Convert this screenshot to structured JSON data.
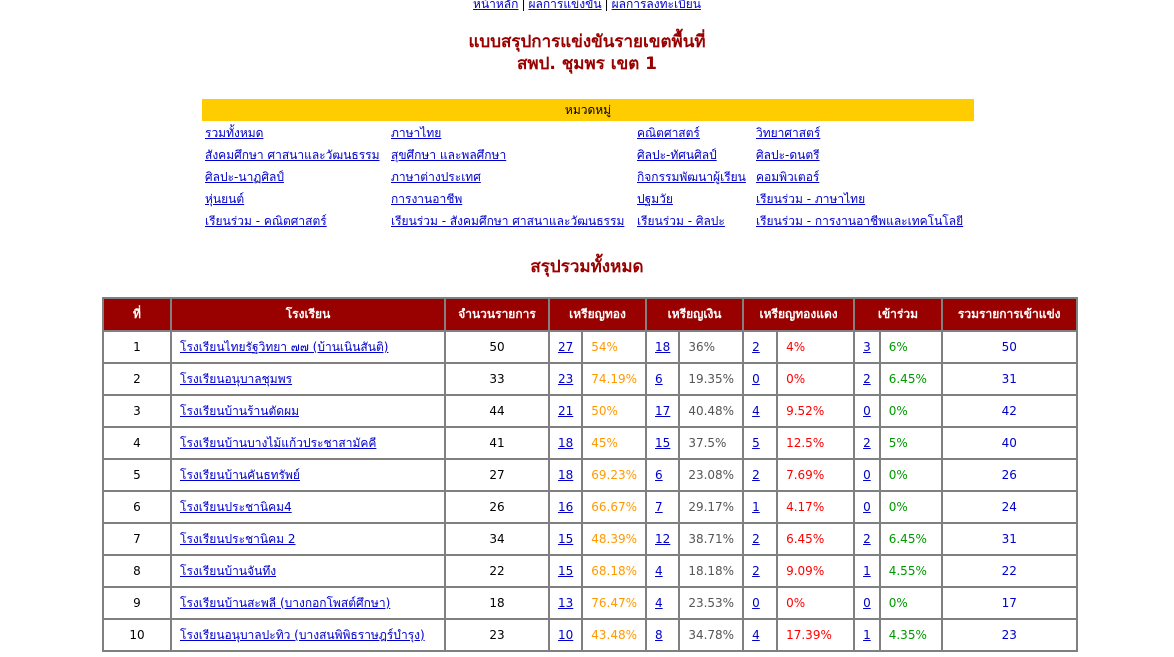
{
  "nav": [
    {
      "label": "หน้าหลัก"
    },
    {
      "label": "ผลการแข่งขัน"
    },
    {
      "label": "ผลการลงทะเบียน"
    }
  ],
  "nav_separator": "|",
  "title": {
    "line1": "แบบสรุปการแข่งขันรายเขตพื้นที่",
    "line2": "สพป. ชุมพร เขต 1"
  },
  "categories_header": "หมวดหมู่",
  "categories": [
    [
      "รวมทั้งหมด",
      "ภาษาไทย",
      "คณิตศาสตร์",
      "วิทยาศาสตร์"
    ],
    [
      "สังคมศึกษา ศาสนาและวัฒนธรรม",
      "สุขศึกษา และพลศึกษา",
      "ศิลปะ-ทัศนศิลป์",
      "ศิลปะ-ดนตรี"
    ],
    [
      "ศิลปะ-นาฏศิลป์",
      "ภาษาต่างประเทศ",
      "กิจกรรมพัฒนาผู้เรียน",
      "คอมพิวเตอร์"
    ],
    [
      "หุ่นยนต์",
      "การงานอาชีพ",
      "ปฐมวัย",
      "เรียนร่วม - ภาษาไทย"
    ],
    [
      "เรียนร่วม - คณิตศาสตร์",
      "เรียนร่วม - สังคมศึกษา ศาสนาและวัฒนธรรม",
      "เรียนร่วม - ศิลปะ",
      "เรียนร่วม - การงานอาชีพและเทคโนโลยี"
    ]
  ],
  "summary_title": "สรุปรวมทั้งหมด",
  "table": {
    "headers": {
      "no": "ที่",
      "school": "โรงเรียน",
      "count": "จำนวนรายการ",
      "gold": "เหรียญทอง",
      "silver": "เหรียญเงิน",
      "bronze": "เหรียญทองแดง",
      "participate": "เข้าร่วม",
      "total": "รวมรายการเข้าแข่ง"
    },
    "rows": [
      {
        "no": "1",
        "school": "โรงเรียนไทยรัฐวิทยา ๗๗ (บ้านเนินสันติ)",
        "count": "50",
        "gold": "27",
        "gold_pct": "54%",
        "silver": "18",
        "silver_pct": "36%",
        "bronze": "2",
        "bronze_pct": "4%",
        "part": "3",
        "part_pct": "6%",
        "total": "50"
      },
      {
        "no": "2",
        "school": "โรงเรียนอนุบาลชุมพร",
        "count": "33",
        "gold": "23",
        "gold_pct": "74.19%",
        "silver": "6",
        "silver_pct": "19.35%",
        "bronze": "0",
        "bronze_pct": "0%",
        "part": "2",
        "part_pct": "6.45%",
        "total": "31"
      },
      {
        "no": "3",
        "school": "โรงเรียนบ้านร้านตัดผม",
        "count": "44",
        "gold": "21",
        "gold_pct": "50%",
        "silver": "17",
        "silver_pct": "40.48%",
        "bronze": "4",
        "bronze_pct": "9.52%",
        "part": "0",
        "part_pct": "0%",
        "total": "42"
      },
      {
        "no": "4",
        "school": "โรงเรียนบ้านบางไม้แก้วประชาสามัคคี",
        "count": "41",
        "gold": "18",
        "gold_pct": "45%",
        "silver": "15",
        "silver_pct": "37.5%",
        "bronze": "5",
        "bronze_pct": "12.5%",
        "part": "2",
        "part_pct": "5%",
        "total": "40"
      },
      {
        "no": "5",
        "school": "โรงเรียนบ้านคันธทรัพย์",
        "count": "27",
        "gold": "18",
        "gold_pct": "69.23%",
        "silver": "6",
        "silver_pct": "23.08%",
        "bronze": "2",
        "bronze_pct": "7.69%",
        "part": "0",
        "part_pct": "0%",
        "total": "26"
      },
      {
        "no": "6",
        "school": "โรงเรียนประชานิคม4",
        "count": "26",
        "gold": "16",
        "gold_pct": "66.67%",
        "silver": "7",
        "silver_pct": "29.17%",
        "bronze": "1",
        "bronze_pct": "4.17%",
        "part": "0",
        "part_pct": "0%",
        "total": "24"
      },
      {
        "no": "7",
        "school": "โรงเรียนประชานิคม 2",
        "count": "34",
        "gold": "15",
        "gold_pct": "48.39%",
        "silver": "12",
        "silver_pct": "38.71%",
        "bronze": "2",
        "bronze_pct": "6.45%",
        "part": "2",
        "part_pct": "6.45%",
        "total": "31"
      },
      {
        "no": "8",
        "school": "โรงเรียนบ้านจันทึง",
        "count": "22",
        "gold": "15",
        "gold_pct": "68.18%",
        "silver": "4",
        "silver_pct": "18.18%",
        "bronze": "2",
        "bronze_pct": "9.09%",
        "part": "1",
        "part_pct": "4.55%",
        "total": "22"
      },
      {
        "no": "9",
        "school": "โรงเรียนบ้านสะพลี (บางกอกโพสต์ศึกษา)",
        "count": "18",
        "gold": "13",
        "gold_pct": "76.47%",
        "silver": "4",
        "silver_pct": "23.53%",
        "bronze": "0",
        "bronze_pct": "0%",
        "part": "0",
        "part_pct": "0%",
        "total": "17"
      },
      {
        "no": "10",
        "school": "โรงเรียนอนุบาลปะทิว (บางสนพิพิธราษฎร์บำรุง)",
        "count": "23",
        "gold": "10",
        "gold_pct": "43.48%",
        "silver": "8",
        "silver_pct": "34.78%",
        "bronze": "4",
        "bronze_pct": "17.39%",
        "part": "1",
        "part_pct": "4.35%",
        "total": "23"
      }
    ]
  },
  "colors": {
    "title": "#990000",
    "category_bar": "#ffcc00",
    "header_bg": "#990000",
    "link": "#0000cc",
    "gold_pct": "#ff9900",
    "bronze_pct": "#ff0000",
    "participate_pct": "#009900"
  }
}
